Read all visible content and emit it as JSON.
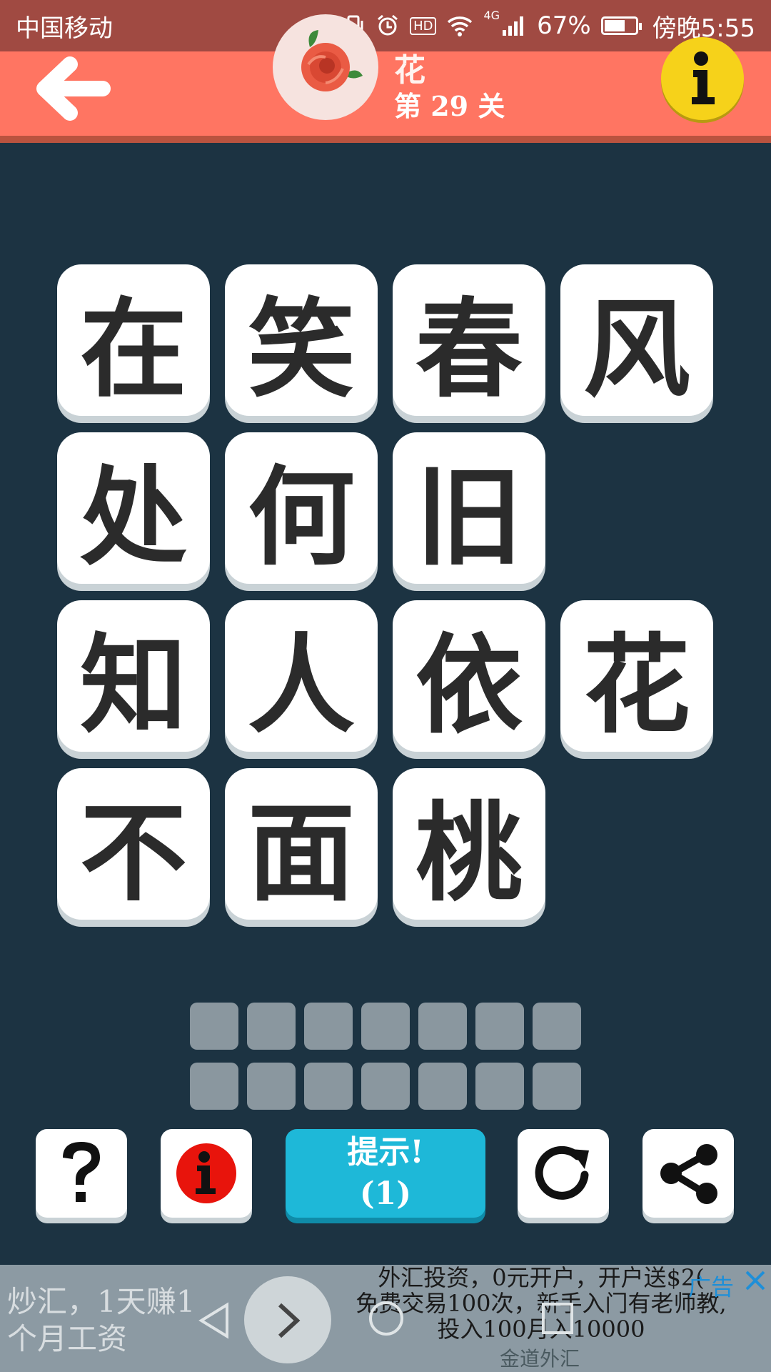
{
  "status_bar": {
    "carrier": "中国移动",
    "network": "4G",
    "hd": "HD",
    "battery_percent": "67%",
    "battery_level": 0.67,
    "time": "傍晚5:55"
  },
  "header": {
    "title": "花",
    "level": "第 29 关",
    "back_icon": "arrow-left-icon",
    "info_icon": "info-icon"
  },
  "tiles": [
    "在",
    "笑",
    "春",
    "风",
    "处",
    "何",
    "旧",
    "知",
    "人",
    "依",
    "花",
    "不",
    "面",
    "桃"
  ],
  "answer_slots": {
    "rows": 2,
    "per_row": 7
  },
  "toolbar": {
    "help_icon": "question-icon",
    "info_icon": "info-icon",
    "hint_label": "提示!",
    "hint_count": "(1)",
    "refresh_icon": "refresh-icon",
    "share_icon": "share-icon"
  },
  "ad": {
    "left_text_1": "炒汇，1天赚1",
    "left_text_2": "个月工资",
    "line1": "外汇投资，0元开户，开户送$2(",
    "line2": "免费交易100次，新手入门有老师教,",
    "line3": "投入100月入10000",
    "tag": "广告",
    "source": "金道外汇"
  },
  "colors": {
    "background": "#1c3342",
    "header": "#ff7562",
    "hint_button": "#1eb8d8",
    "info_yellow": "#f6d21a",
    "info_red": "#e8140c"
  }
}
